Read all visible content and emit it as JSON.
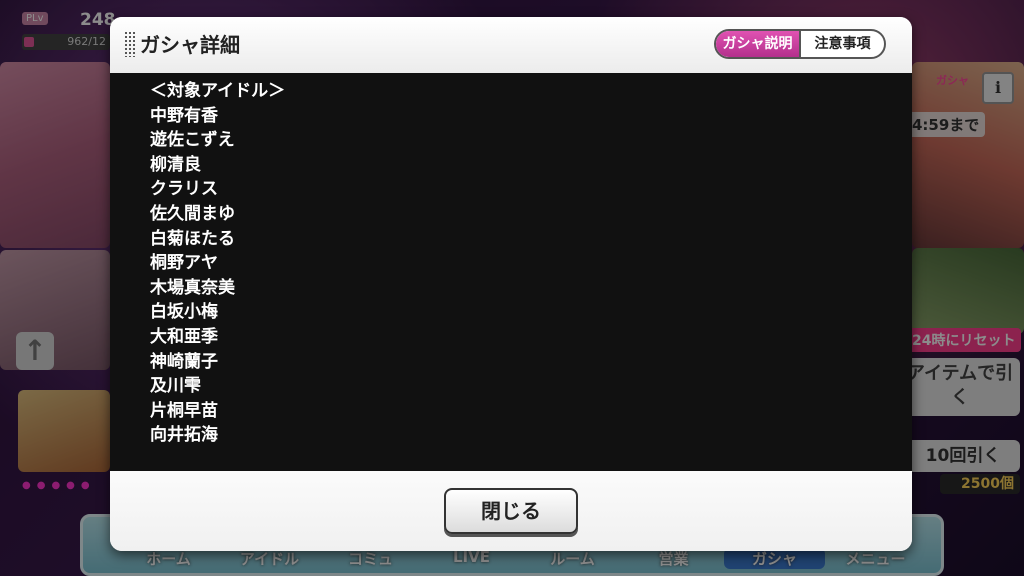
{
  "background": {
    "plv_label": "PLv",
    "plv_value": "248",
    "exp": "962/12",
    "gacha_tag": "ガシャ",
    "info_label": "i",
    "time_text": "4:59まで",
    "reset_text": "24時にリセット",
    "item_button": "アイテムで引く",
    "ten_draw_button": "10回引く",
    "cost": "2500個"
  },
  "nav": {
    "items": [
      "ホーム",
      "アイドル",
      "コミュ",
      "LIVE",
      "ルーム",
      "営業",
      "ガシャ",
      "メニュー"
    ],
    "active_index": 6
  },
  "modal": {
    "title": "ガシャ詳細",
    "tabs": [
      {
        "label": "ガシャ説明",
        "active": true
      },
      {
        "label": "注意事項",
        "active": false
      }
    ],
    "list_heading": "＜対象アイドル＞",
    "idols": [
      "中野有香",
      "遊佐こずえ",
      "柳清良",
      "クラリス",
      "佐久間まゆ",
      "白菊ほたる",
      "桐野アヤ",
      "木場真奈美",
      "白坂小梅",
      "大和亜季",
      "神崎蘭子",
      "及川雫",
      "片桐早苗",
      "向井拓海"
    ],
    "close_button": "閉じる"
  },
  "colors": {
    "tab_active": "#c93a9e",
    "content_bg": "#111111",
    "reset_pink": "#ff3f8e",
    "cost_yellow": "#ffd35a"
  }
}
